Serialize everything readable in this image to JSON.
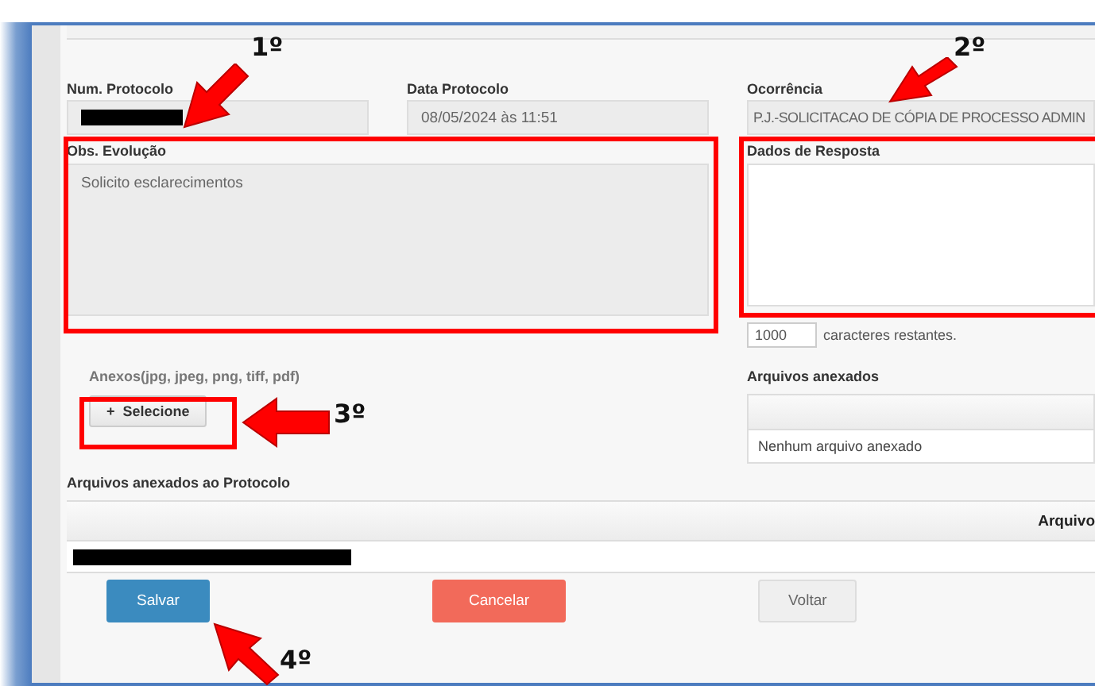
{
  "protocol": {
    "number_label": "Num. Protocolo",
    "date_label": "Data Protocolo",
    "date_value": "08/05/2024 às 11:51",
    "occurrence_label": "Ocorrência",
    "occurrence_value": "P.J.-SOLICITACAO DE CÓPIA DE PROCESSO ADMIN"
  },
  "observation": {
    "label": "Obs. Evolução",
    "value": "Solicito esclarecimentos"
  },
  "response": {
    "label": "Dados de Resposta",
    "counter": "1000",
    "counter_text": "caracteres restantes."
  },
  "attachment": {
    "label": "Anexos(jpg, jpeg, png, tiff, pdf)",
    "button_icon": "+",
    "button": "Selecione"
  },
  "attached_files": {
    "label": "Arquivos anexados",
    "empty": "Nenhum arquivo anexado"
  },
  "protocol_files": {
    "label": "Arquivos anexados ao Protocolo",
    "column": "Arquivo"
  },
  "buttons": [
    {
      "label": "Salvar",
      "kind": "primary"
    },
    {
      "label": "Cancelar",
      "kind": "danger"
    },
    {
      "label": "Voltar",
      "kind": "default"
    }
  ],
  "annotations": [
    "1º",
    "2º",
    "3º",
    "4º"
  ]
}
